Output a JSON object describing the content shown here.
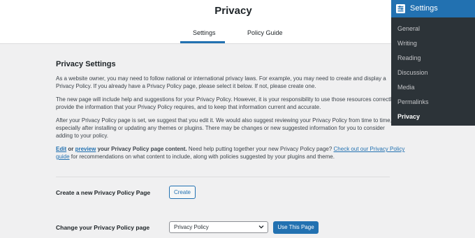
{
  "header": {
    "title": "Privacy",
    "tabs": [
      {
        "label": "Settings"
      },
      {
        "label": "Policy Guide"
      }
    ]
  },
  "main": {
    "section_title": "Privacy Settings",
    "p1_line1": "As a website owner, you may need to follow national or international privacy laws. For example, you may need to create and display a",
    "p1_line2": "Privacy Policy. If you already have a Privacy Policy page, please select it below. If not, please create one.",
    "p2_line1": "The new page will include help and suggestions for your Privacy Policy. However, it is your responsibility to use those resources correctly, to",
    "p2_line2": "provide the information that your Privacy Policy requires, and to keep that information current and accurate.",
    "p3_line1": "After your Privacy Policy page is set, we suggest that you edit it. We would also suggest reviewing your Privacy Policy from time to time,",
    "p3_line2": "especially after installing or updating any themes or plugins. There may be changes or new suggested information for you to consider",
    "p3_line3": "adding to your policy.",
    "p4_edit": "Edit",
    "p4_or": " or ",
    "p4_preview": "preview",
    "p4_rest": " your Privacy Policy page content.",
    "p4_need": " Need help putting together your new Privacy Policy page? ",
    "p4_link": "Check out our Privacy Policy",
    "p4_link2": "guide",
    "p4_tail": " for recommendations on what content to include, along with policies suggested by your plugins and theme.",
    "create_label": "Create a new Privacy Policy Page",
    "create_button": "Create",
    "change_label": "Change your Privacy Policy page",
    "select_value": "Privacy Policy",
    "use_button": "Use This Page"
  },
  "sidebar": {
    "header": "Settings",
    "header_icon": "settings-icon",
    "items": [
      {
        "label": "General"
      },
      {
        "label": "Writing"
      },
      {
        "label": "Reading"
      },
      {
        "label": "Discussion"
      },
      {
        "label": "Media"
      },
      {
        "label": "Permalinks"
      },
      {
        "label": "Privacy"
      }
    ]
  },
  "colors": {
    "accent": "#2271b1",
    "menu_bg": "#2c3338",
    "page_bg": "#f0f0f1"
  }
}
